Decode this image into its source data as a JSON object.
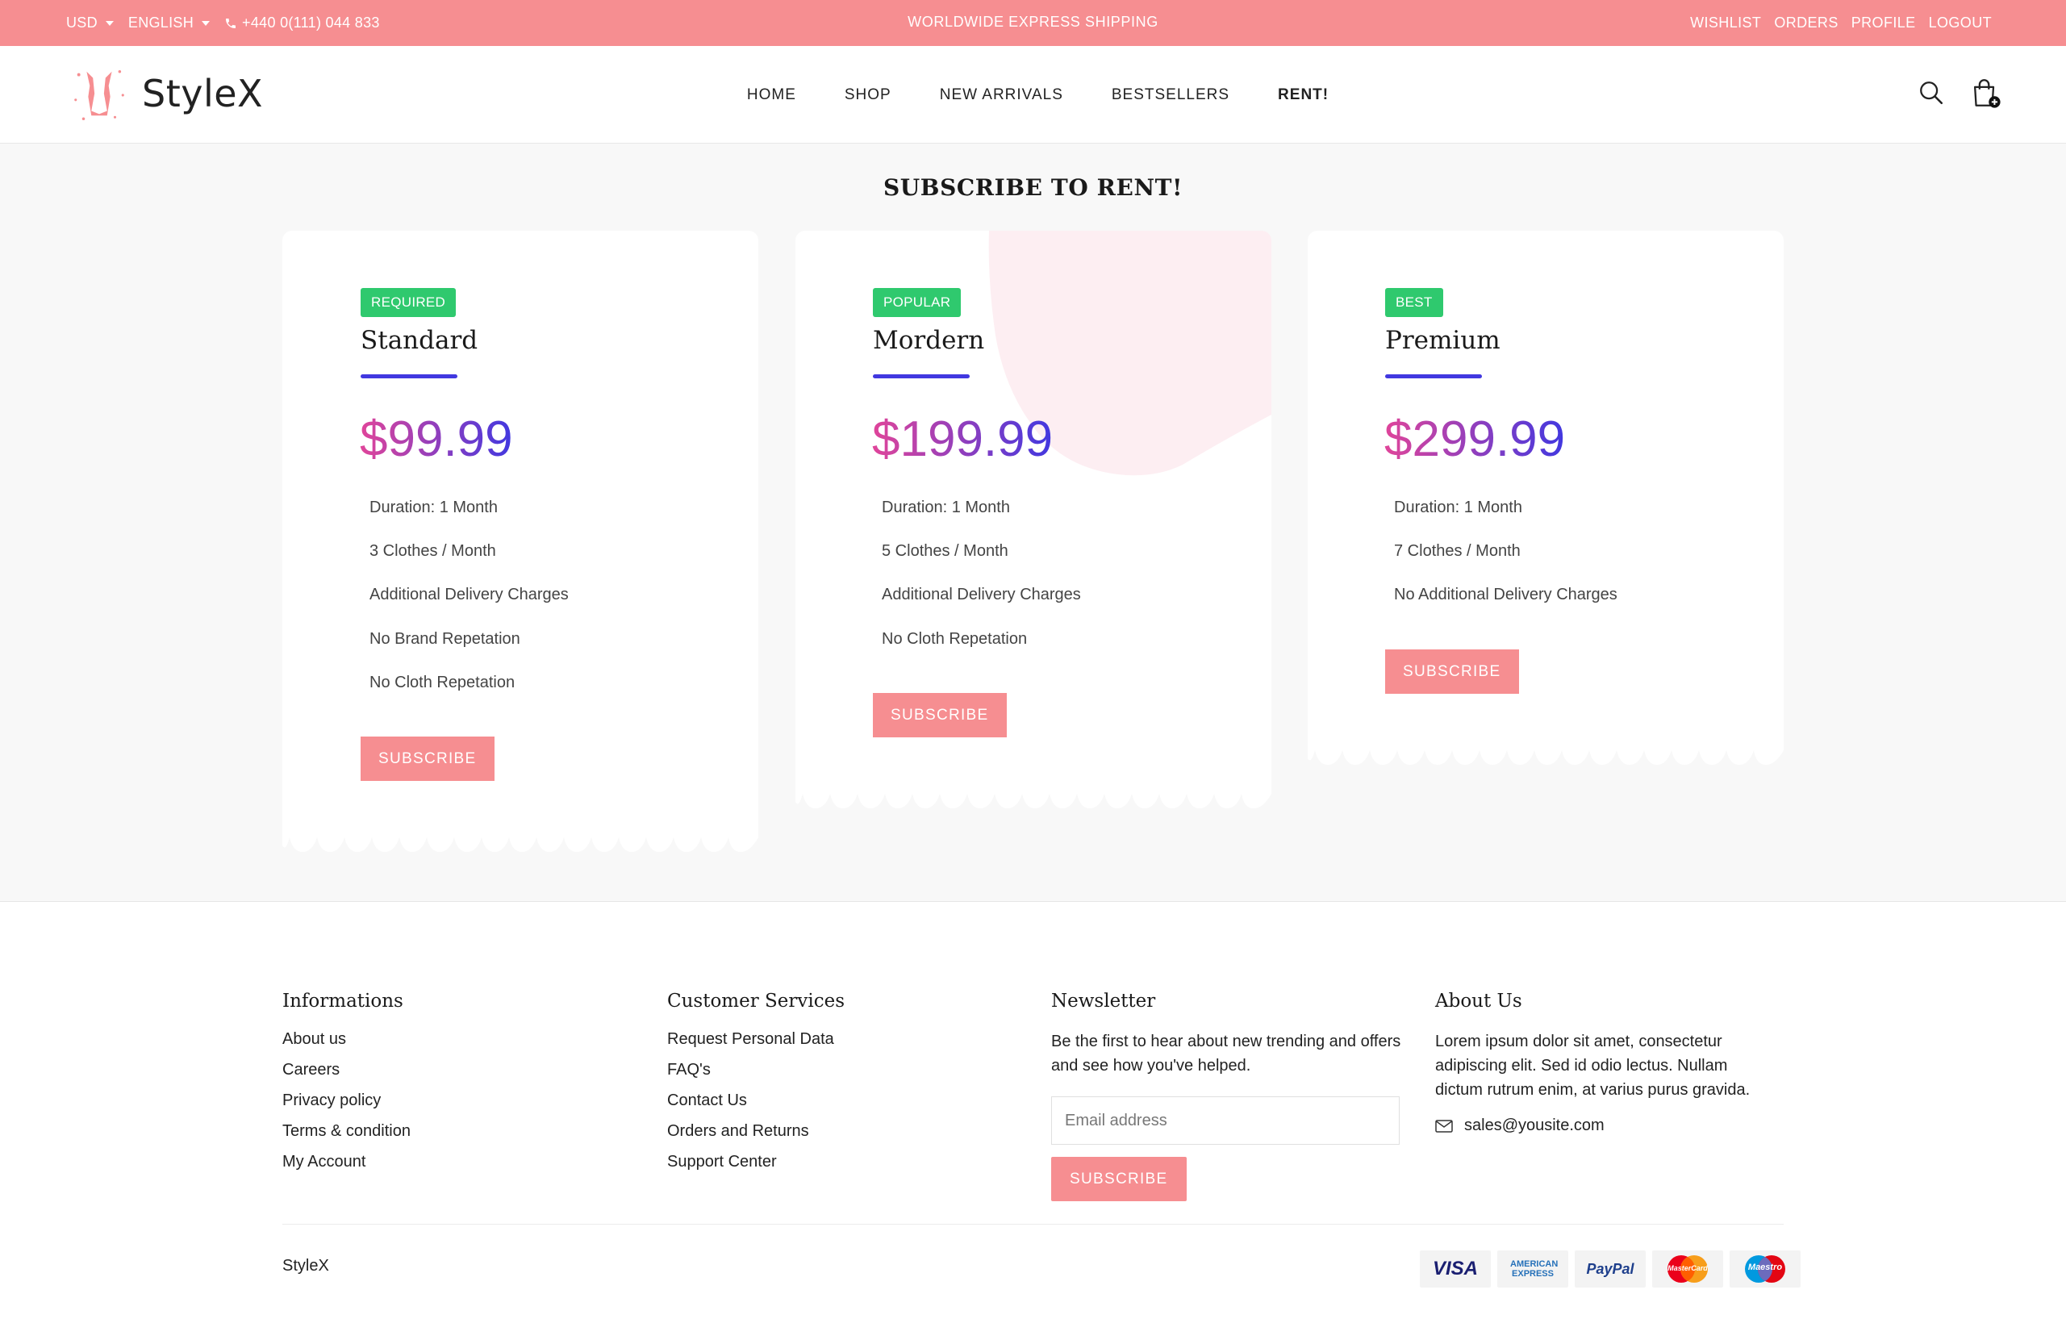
{
  "topbar": {
    "currency": "USD",
    "language": "ENGLISH",
    "phone": "+440 0(111) 044 833",
    "promo": "WORLDWIDE EXPRESS SHIPPING",
    "links": [
      "WISHLIST",
      "ORDERS",
      "PROFILE",
      "LOGOUT"
    ]
  },
  "header": {
    "brand": "StyleX",
    "nav": [
      "HOME",
      "SHOP",
      "NEW ARRIVALS",
      "BESTSELLERS",
      "RENT!"
    ],
    "active_nav": "RENT!",
    "icons": [
      "search-icon",
      "cart-icon"
    ]
  },
  "pricing": {
    "title": "SUBSCRIBE TO RENT!",
    "plans": [
      {
        "badge": "REQUIRED",
        "name": "Standard",
        "price": "$99.99",
        "features": [
          "Duration: 1 Month",
          "3 Clothes / Month",
          "Additional Delivery Charges",
          "No Brand Repetation",
          "No Cloth Repetation"
        ],
        "button": "SUBSCRIBE"
      },
      {
        "badge": "POPULAR",
        "name": "Mordern",
        "price": "$199.99",
        "features": [
          "Duration: 1 Month",
          "5 Clothes / Month",
          "Additional Delivery Charges",
          "No Cloth Repetation"
        ],
        "button": "SUBSCRIBE"
      },
      {
        "badge": "BEST",
        "name": "Premium",
        "price": "$299.99",
        "features": [
          "Duration: 1 Month",
          "7 Clothes / Month",
          "No Additional Delivery Charges"
        ],
        "button": "SUBSCRIBE"
      }
    ]
  },
  "footer": {
    "informations": {
      "title": "Informations",
      "links": [
        "About us",
        "Careers",
        "Privacy policy",
        "Terms & condition",
        "My Account"
      ]
    },
    "customer_services": {
      "title": "Customer Services",
      "links": [
        "Request Personal Data",
        "FAQ's",
        "Contact Us",
        "Orders and Returns",
        "Support Center"
      ]
    },
    "newsletter": {
      "title": "Newsletter",
      "text": "Be the first to hear about new trending and offers and see how you've helped.",
      "placeholder": "Email address",
      "button": "SUBSCRIBE"
    },
    "about": {
      "title": "About Us",
      "text": "Lorem ipsum dolor sit amet, consectetur adipiscing elit. Sed id odio lectus. Nullam dictum rutrum enim, at varius purus gravida.",
      "email": "sales@yousite.com"
    },
    "copyright": "StyleX",
    "payments": [
      "VISA",
      "AMERICAN EXPRESS",
      "PayPal",
      "MasterCard",
      "Maestro"
    ]
  },
  "colors": {
    "accent": "#f68e91",
    "badge_green": "#2fc96e",
    "underline_blue": "#4138e0",
    "price_gradient_start": "#e0459a",
    "price_gradient_end": "#4138e0",
    "blob_pink": "#fdeef2"
  }
}
